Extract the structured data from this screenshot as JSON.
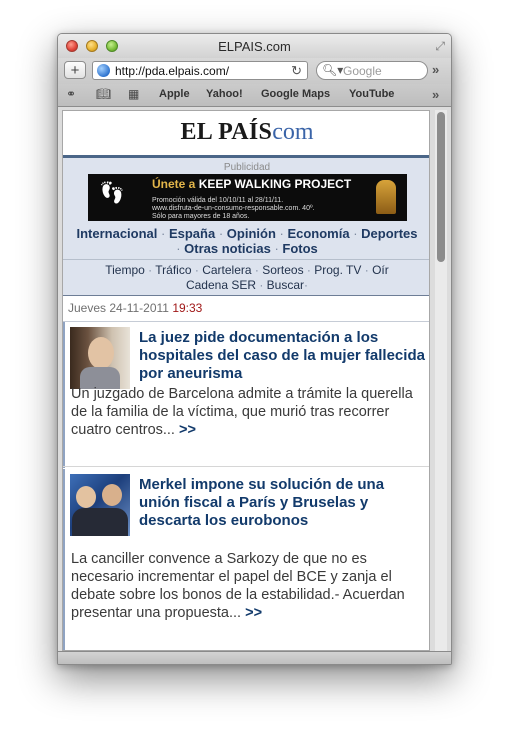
{
  "window": {
    "title": "ELPAIS.com"
  },
  "toolbar": {
    "url": "http://pda.elpais.com/",
    "search_placeholder": "Google"
  },
  "bookmarks": [
    "Apple",
    "Yahoo!",
    "Google Maps",
    "YouTube"
  ],
  "page": {
    "logo_main": "EL PAÍS",
    "logo_suffix": "com",
    "ad_label": "Publicidad",
    "ad": {
      "headline_a": "Únete a",
      "headline_b": "KEEP WALKING PROJECT",
      "line1": "Promoción válida del 10/10/11 al 28/11/11.",
      "line2": "www.disfruta-de-un-consumo-responsable.com. 40º.",
      "line3": "Sólo para mayores de 18 años."
    },
    "sections": [
      "Internacional",
      "España",
      "Opinión",
      "Economía",
      "Deportes",
      "Otras noticias",
      "Fotos"
    ],
    "utilities": [
      "Tiempo",
      "Tráfico",
      "Cartelera",
      "Sorteos",
      "Prog. TV",
      "Oír",
      "Cadena SER",
      "Buscar"
    ],
    "date": "Jueves 24-11-2011",
    "time": "19:33",
    "articles": [
      {
        "headline": "La juez pide documentación a los hospitales del caso de la mujer fallecida por aneurisma",
        "summary": "Un juzgado de Barcelona admite a trámite la querella de la familia de la víctima, que murió tras recorrer cuatro centros...",
        "more": ">>"
      },
      {
        "headline": "Merkel impone su solución de una unión fiscal a París y Bruselas y descarta los eurobonos",
        "summary": "La canciller convence a Sarkozy de que no es necesario incrementar el papel del BCE y zanja el debate sobre los bonos de la estabilidad.- Acuerdan presentar una propuesta...",
        "more": ">>"
      }
    ]
  }
}
